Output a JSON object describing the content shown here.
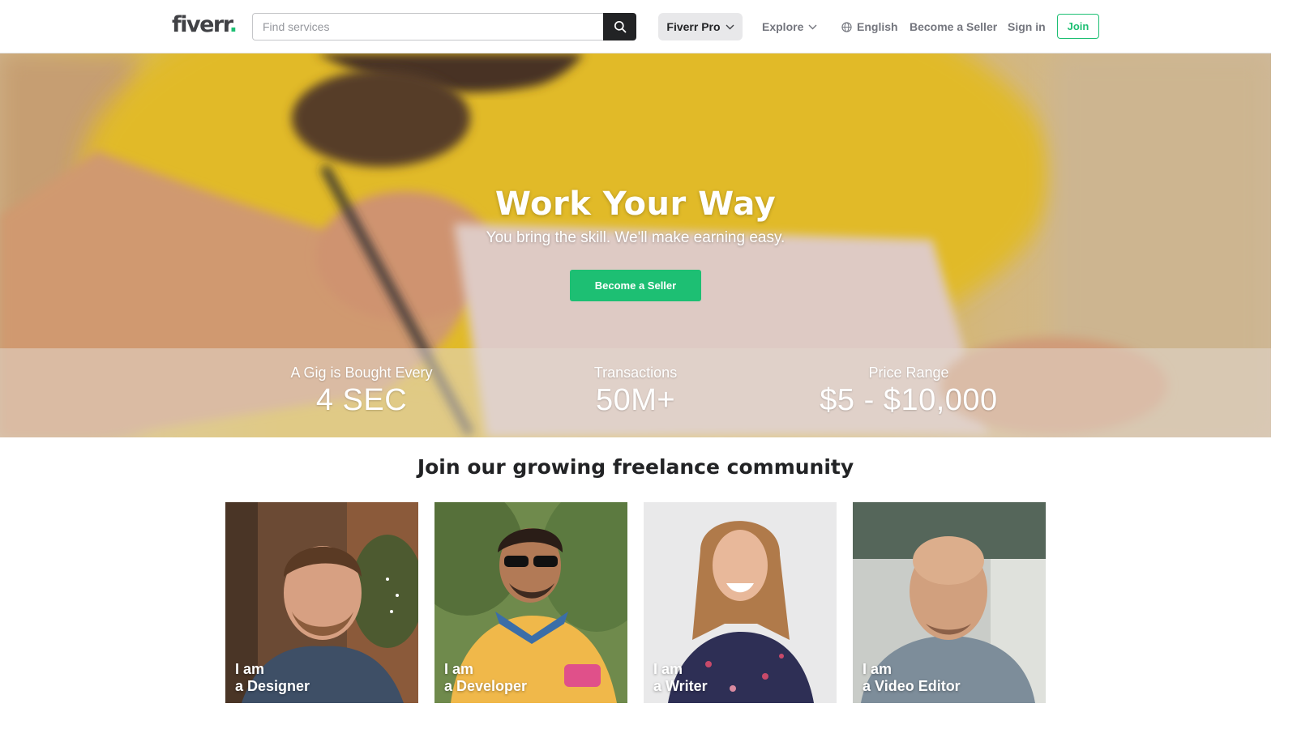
{
  "header": {
    "logo_text": "fiverr",
    "logo_dot": ".",
    "search": {
      "placeholder": "Find services"
    },
    "pro_label": "Fiverr Pro",
    "explore_label": "Explore",
    "language_label": "English",
    "become_seller_label": "Become a Seller",
    "sign_in_label": "Sign in",
    "join_label": "Join",
    "icons": {
      "search": "search-icon",
      "chevron": "chevron-down-icon",
      "globe": "globe-icon"
    }
  },
  "hero": {
    "title": "Work Your Way",
    "subtitle": "You bring the skill. We'll make earning easy.",
    "cta_label": "Become a Seller",
    "stats": [
      {
        "label": "A Gig is Bought Every",
        "value": "4 SEC"
      },
      {
        "label": "Transactions",
        "value": "50M+"
      },
      {
        "label": "Price Range",
        "value": "$5 - $10,000"
      }
    ]
  },
  "community": {
    "title": "Join our growing freelance community",
    "cards": [
      {
        "line1": "I am",
        "line2": "a Designer"
      },
      {
        "line1": "I am",
        "line2": "a Developer"
      },
      {
        "line1": "I am",
        "line2": "a Writer"
      },
      {
        "line1": "I am",
        "line2": "a Video Editor"
      }
    ]
  },
  "colors": {
    "brand_green": "#1dbf73",
    "text_dark": "#222325",
    "text_muted": "#74767e"
  }
}
